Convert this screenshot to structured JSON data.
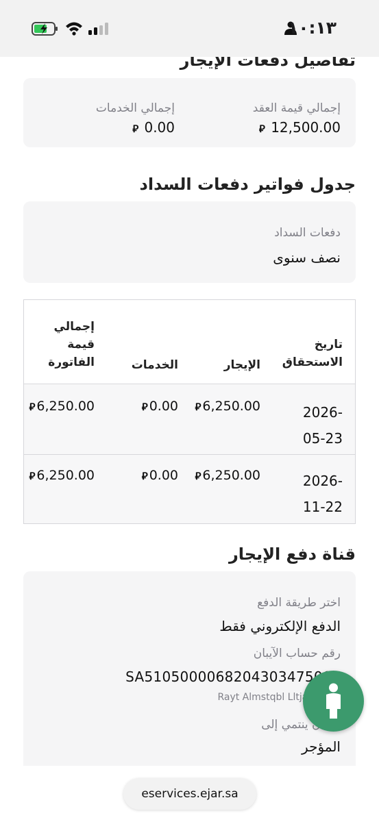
{
  "status_bar": {
    "time": "١٠:١٣"
  },
  "lease_payments": {
    "title": "تفاصيل دفعات الإيجار",
    "contract_total_label": "إجمالي قيمة العقد",
    "contract_total_value": "12,500.00",
    "services_total_label": "إجمالي الخدمات",
    "services_total_value": "0.00"
  },
  "schedule": {
    "title": "جدول فواتير دفعات السداد",
    "frequency_label": "دفعات السداد",
    "frequency_value": "نصف سنوى"
  },
  "currency_symbol": "⃁",
  "table": {
    "headers": {
      "due_date": [
        "تاريخ",
        "الاستحقاق"
      ],
      "rent": "الإيجار",
      "services": "الخدمات",
      "invoice_total": [
        "إجمالي",
        "قيمة",
        "الفاتورة"
      ]
    },
    "rows": [
      {
        "date_line1": "2026-",
        "date_line2": "05-23",
        "rent": "6,250.00",
        "services": "0.00",
        "total": "6,250.00"
      },
      {
        "date_line1": "2026-",
        "date_line2": "11-22",
        "rent": "6,250.00",
        "services": "0.00",
        "total": "6,250.00"
      }
    ]
  },
  "payment_channel": {
    "title": "قناة دفع الإيجار",
    "method_label": "اختر طريقة الدفع",
    "method_value": "الدفع الإلكتروني فقط",
    "iban_label": "رقم حساب الآيبان",
    "iban_value": "SA5105000068204303475000",
    "account_name": "Rayt Almstqbl Lltjart Com",
    "owner_label": "الآيبان ينتمي إلى",
    "owner_value": "المؤجر"
  },
  "fab": {
    "icon": "accessibility-person-icon",
    "color": "#3c9a6d"
  },
  "browser": {
    "url": "eservices.ejar.sa"
  }
}
